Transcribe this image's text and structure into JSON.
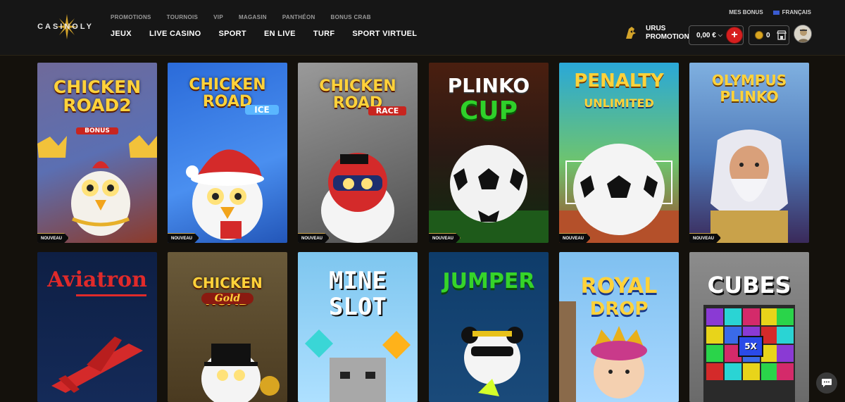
{
  "brand": {
    "logo_text": "CASINOLY"
  },
  "topnav": [
    "PROMOTIONS",
    "TOURNOIS",
    "VIP",
    "MAGASIN",
    "PANTHÉON",
    "BONUS CRAB"
  ],
  "mainnav": [
    "JEUX",
    "LIVE CASINO",
    "SPORT",
    "EN LIVE",
    "TURF",
    "SPORT VIRTUEL"
  ],
  "top_right": {
    "bonus": "MES BONUS",
    "language": "FRANÇAIS"
  },
  "promo": {
    "line1": "URUS",
    "line2": "PROMOTION"
  },
  "balance": {
    "amount": "0,00 €",
    "plus": "+"
  },
  "coins": {
    "count": "0"
  },
  "games": [
    {
      "title": "CHICKEN ROAD2",
      "sub": "BONUS",
      "badge": "NOUVEAU"
    },
    {
      "title": "CHICKEN ROAD",
      "sub": "ICE",
      "badge": "NOUVEAU"
    },
    {
      "title": "CHICKEN ROAD",
      "sub": "RACE",
      "badge": "NOUVEAU"
    },
    {
      "title": "PLINKO",
      "sub": "CUP",
      "badge": "NOUVEAU"
    },
    {
      "title": "PENALTY",
      "sub": "UNLIMITED",
      "badge": "NOUVEAU"
    },
    {
      "title": "OLYMPUS",
      "sub": "PLINKO",
      "badge": "NOUVEAU"
    },
    {
      "title": "Aviatron",
      "sub": "",
      "badge": ""
    },
    {
      "title": "CHICKEN ROAD",
      "sub": "Gold",
      "badge": ""
    },
    {
      "title": "MINE",
      "sub": "SLOT",
      "badge": ""
    },
    {
      "title": "JUMPER",
      "sub": "",
      "badge": ""
    },
    {
      "title": "ROYAL",
      "sub": "DROP",
      "badge": ""
    },
    {
      "title": "CUBES",
      "sub": "5X",
      "badge": ""
    }
  ],
  "colors": {
    "accent_gold": "#c9a24a",
    "accent_red": "#d61f1f",
    "bg": "#14110c"
  }
}
